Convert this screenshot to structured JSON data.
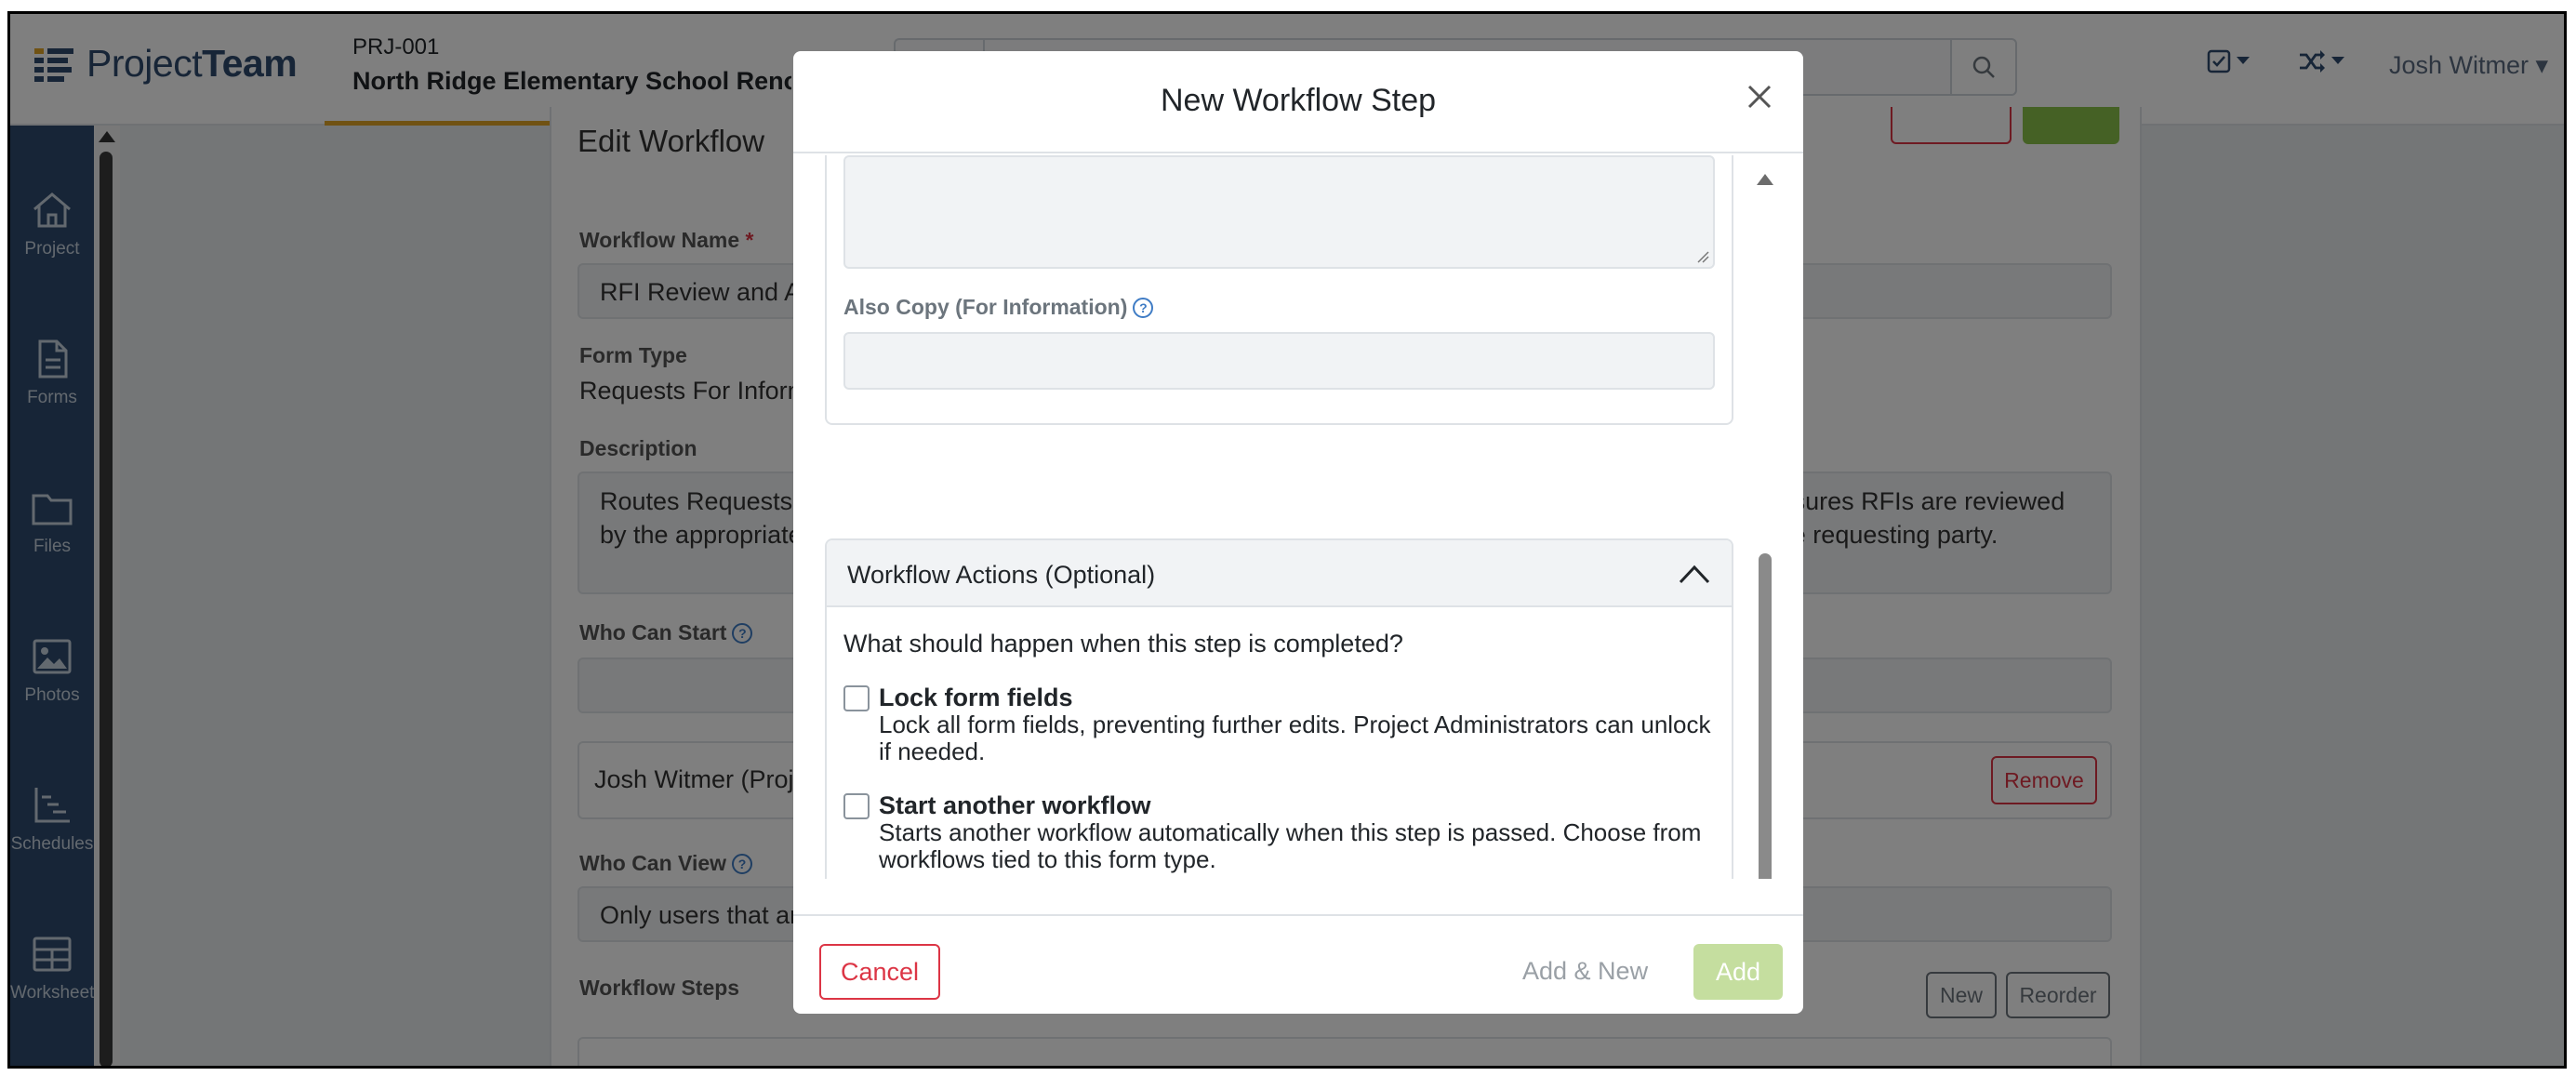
{
  "app": {
    "logo_text_regular": "Project",
    "logo_text_bold": "Team",
    "project_code": "PRJ-001",
    "project_name": "North Ridge Elementary School Renovation"
  },
  "user_menu": {
    "label": "Josh Witmer ▾"
  },
  "sidebar": {
    "items": [
      {
        "label": "Project",
        "icon": "home-icon"
      },
      {
        "label": "Forms",
        "icon": "document-icon"
      },
      {
        "label": "Files",
        "icon": "folder-icon"
      },
      {
        "label": "Photos",
        "icon": "image-icon"
      },
      {
        "label": "Schedules",
        "icon": "chart-icon"
      },
      {
        "label": "Worksheets",
        "icon": "table-icon"
      }
    ]
  },
  "page": {
    "title": "Edit Workflow",
    "workflow_name_label": "Workflow Name",
    "workflow_name_required": "*",
    "workflow_name_value": "RFI Review and Approval Workflow",
    "form_type_label": "Form Type",
    "form_type_value": "Requests For Information",
    "description_label": "Description",
    "description_value": "Routes Requests For Information (RFIs) through review and response by the design team. The workflow ensures RFIs are reviewed by the appropriate parties, answered in a timely manner, escalated when needed, and distributed back to the requesting party.",
    "who_can_start_label": "Who Can Start",
    "who_can_start_person": "Josh Witmer (Project Administrator)",
    "remove_label": "Remove",
    "who_can_view_label": "Who Can View",
    "who_can_view_value": "Only users that are in the workflow",
    "workflow_steps_label": "Workflow Steps",
    "new_label": "New",
    "reorder_label": "Reorder"
  },
  "modal": {
    "title": "New Workflow Step",
    "also_copy_label": "Also Copy (For Information)",
    "actions_title": "Workflow Actions (Optional)",
    "actions_question": "What should happen when this step is completed?",
    "options": [
      {
        "title": "Lock form fields",
        "desc": "Lock all form fields, preventing further edits. Project Administrators can unlock if needed.",
        "checked": false
      },
      {
        "title": "Start another workflow",
        "desc": "Starts another workflow automatically when this step is passed. Choose from workflows tied to this form type.",
        "checked": false
      }
    ],
    "cancel_label": "Cancel",
    "add_new_label": "Add & New",
    "add_label": "Add"
  },
  "colors": {
    "brand": "#2f4b6e",
    "accent": "#e0a526",
    "danger": "#dc3545",
    "success_disabled": "#c5de9f",
    "link_blue": "#3f7cc5"
  }
}
